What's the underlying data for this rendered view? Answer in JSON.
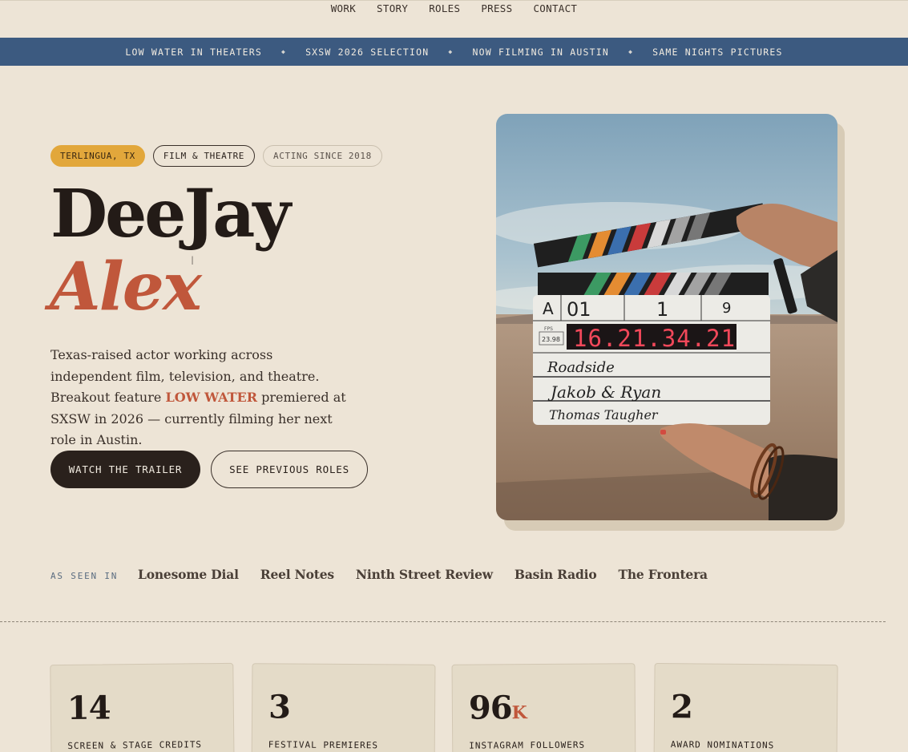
{
  "nav": {
    "items": [
      "WORK",
      "STORY",
      "ROLES",
      "PRESS",
      "CONTACT"
    ]
  },
  "ticker": {
    "items": [
      "LOW WATER IN THEATERS",
      "SXSW 2026 SELECTION",
      "NOW FILMING IN AUSTIN",
      "SAME NIGHTS PICTURES"
    ],
    "separator": "◆"
  },
  "tags": [
    "TERLINGUA, TX",
    "FILM & THEATRE",
    "ACTING SINCE 2018"
  ],
  "hero": {
    "first_name": "DeeJay",
    "last_name": "Alex",
    "bio_part1": "Texas-raised actor working across independent film, television, and theatre. Breakout feature ",
    "bio_highlight": "LOW WATER",
    "bio_part2": " premiered at SXSW in 2026 — currently filming her next role in Austin."
  },
  "buttons": {
    "primary": "WATCH THE TRAILER",
    "secondary": "SEE PREVIOUS ROLES"
  },
  "photo": {
    "slate": {
      "roll": "A",
      "scene": "01",
      "shot": "1",
      "take": "9",
      "fps_label": "FPS",
      "fps": "23.98",
      "timecode": "16.21.34.21",
      "production": "Roadside",
      "director": "Jakob & Ryan",
      "camera": "Thomas Taugher"
    }
  },
  "press": {
    "label": "AS SEEN IN",
    "outlets": [
      "Lonesome Dial",
      "Reel Notes",
      "Ninth Street Review",
      "Basin Radio",
      "The Frontera"
    ]
  },
  "stats": [
    {
      "value": "14",
      "suffix": "",
      "label": "SCREEN & STAGE CREDITS"
    },
    {
      "value": "3",
      "suffix": "",
      "label": "FESTIVAL PREMIERES"
    },
    {
      "value": "96",
      "suffix": "K",
      "label": "INSTAGRAM FOLLOWERS"
    },
    {
      "value": "2",
      "suffix": "",
      "label": "AWARD NOMINATIONS"
    }
  ],
  "colors": {
    "background": "#ede4d6",
    "ticker": "#3c5a80",
    "accent": "#c0573b",
    "gold": "#e2a73b",
    "ink": "#2a211c"
  }
}
